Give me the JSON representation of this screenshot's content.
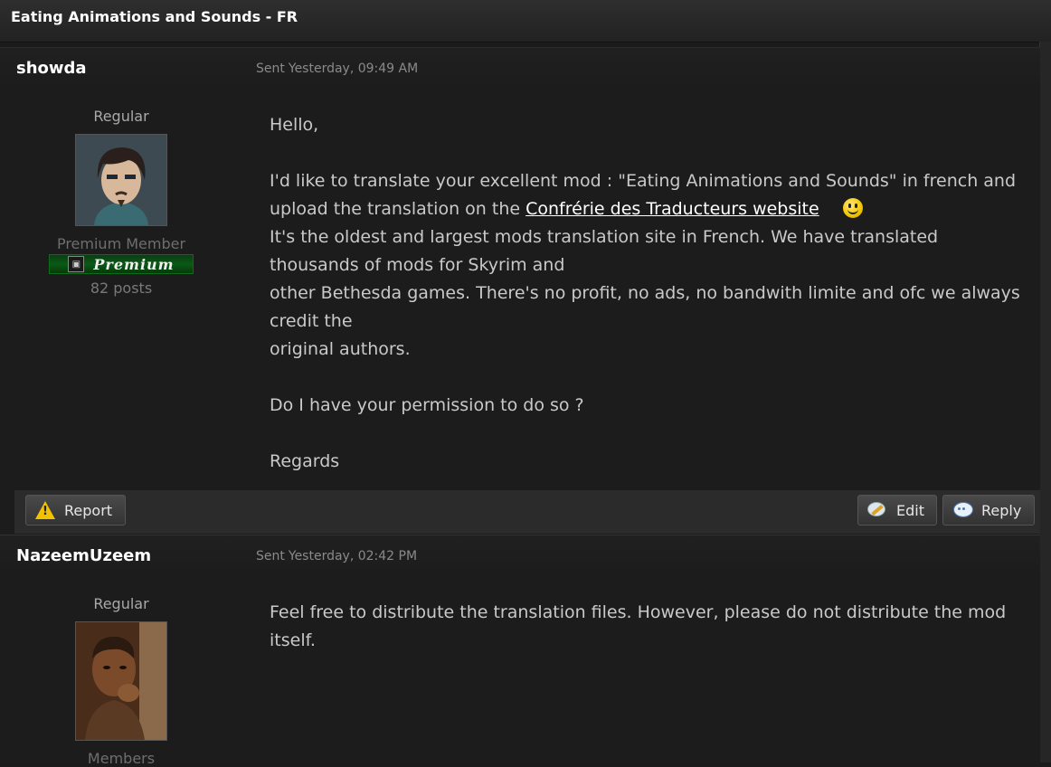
{
  "window": {
    "title": "Eating Animations and Sounds - FR"
  },
  "posts": [
    {
      "username": "showda",
      "sent_label": "Sent",
      "sent_time": "Yesterday, 09:49 AM",
      "rank": "Regular",
      "member_title": "Premium Member",
      "badge_text": "Premium",
      "post_count": "82 posts",
      "body": {
        "greeting": "Hello,",
        "line1": "I'd like to translate your excellent mod : \"Eating Animations and Sounds\" in french and",
        "line2_before": "upload the translation on the ",
        "link_text": "Confrérie des Traducteurs website",
        "line3": "It's the oldest and largest mods translation site in French. We have translated",
        "line4": "thousands of mods for Skyrim and",
        "line5": "other Bethesda games. There's no profit, no ads, no bandwith limite and ofc we always",
        "line6": "credit the",
        "line7": "original authors.",
        "question": "Do I have your permission to do so ?",
        "closing": "Regards"
      },
      "actions": {
        "report": "Report",
        "edit": "Edit",
        "reply": "Reply"
      }
    },
    {
      "username": "NazeemUzeem",
      "sent_label": "Sent",
      "sent_time": "Yesterday, 02:42 PM",
      "rank": "Regular",
      "member_title": "Members",
      "body": {
        "text": "Feel free to distribute the translation files. However, please do not distribute the mod itself."
      }
    }
  ],
  "icons": {
    "report": "warning-icon",
    "edit": "edit-icon",
    "reply": "reply-icon",
    "smiley": "smiley-icon"
  },
  "colors": {
    "background": "#1b1b1b",
    "premium_badge": "#0a5a16",
    "link": "#ffffff"
  }
}
